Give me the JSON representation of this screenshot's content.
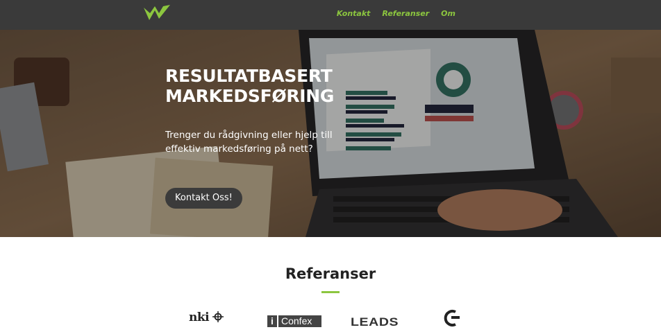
{
  "header": {
    "logo_name": "brand-logo",
    "nav": [
      {
        "label": "Kontakt"
      },
      {
        "label": "Referanser"
      },
      {
        "label": "Om"
      }
    ]
  },
  "hero": {
    "title_line1": "RESULTATBASERT",
    "title_line2": "MARKEDSFØRING",
    "subtitle": "Trenger du rådgivning eller hjelp till effektiv markedsføring på nett?",
    "cta_label": "Kontakt Oss!"
  },
  "references": {
    "title": "Referanser",
    "clients": [
      {
        "name": "nki"
      },
      {
        "name": "Confex"
      },
      {
        "name": "LEADS"
      }
    ]
  },
  "colors": {
    "accent": "#8cc63f",
    "header_bg": "#3a3a3a",
    "button_bg": "#3b3b3b"
  }
}
